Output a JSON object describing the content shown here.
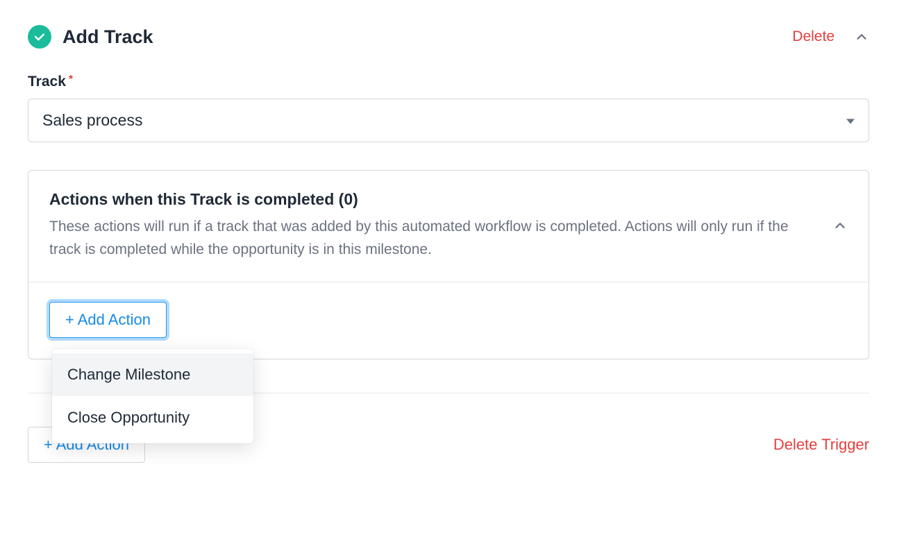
{
  "header": {
    "title": "Add Track",
    "delete_label": "Delete"
  },
  "track_field": {
    "label": "Track",
    "value": "Sales process"
  },
  "actions_panel": {
    "title": "Actions when this Track is completed (0)",
    "description": "These actions will run if a track that was added by this automated workflow is completed. Actions will only run if the track is completed while the opportunity is in this milestone.",
    "add_button_label": "+ Add Action",
    "menu": {
      "items": [
        {
          "label": "Change Milestone"
        },
        {
          "label": "Close Opportunity"
        }
      ]
    }
  },
  "footer": {
    "add_action_label": "+ Add Action",
    "delete_trigger_label": "Delete Trigger"
  },
  "colors": {
    "accent_green": "#1abc9c",
    "danger": "#e53e3e",
    "primary_blue": "#178be6"
  }
}
